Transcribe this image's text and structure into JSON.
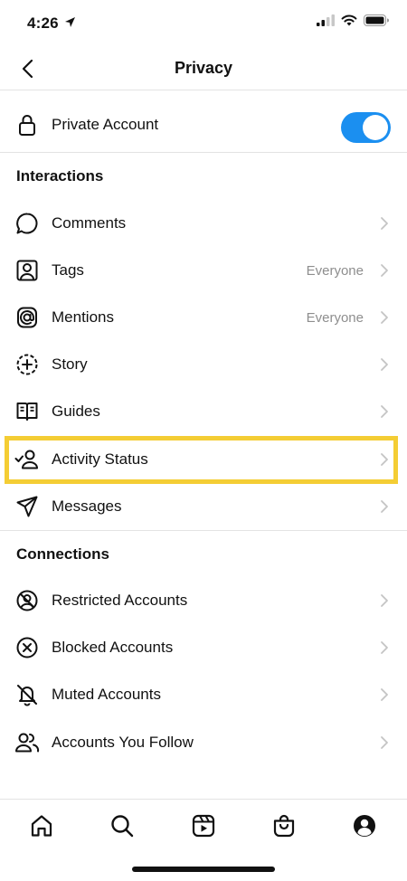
{
  "status_bar": {
    "time": "4:26"
  },
  "nav": {
    "title": "Privacy"
  },
  "private_account": {
    "label": "Private Account",
    "enabled": true
  },
  "interactions": {
    "header": "Interactions",
    "items": [
      {
        "label": "Comments",
        "value": "",
        "icon": "comment-icon"
      },
      {
        "label": "Tags",
        "value": "Everyone",
        "icon": "tag-person-icon"
      },
      {
        "label": "Mentions",
        "value": "Everyone",
        "icon": "at-sign-icon"
      },
      {
        "label": "Story",
        "value": "",
        "icon": "story-add-icon"
      },
      {
        "label": "Guides",
        "value": "",
        "icon": "guide-book-icon"
      },
      {
        "label": "Activity Status",
        "value": "",
        "icon": "activity-status-icon",
        "highlighted": true
      },
      {
        "label": "Messages",
        "value": "",
        "icon": "paper-plane-icon"
      }
    ]
  },
  "connections": {
    "header": "Connections",
    "items": [
      {
        "label": "Restricted Accounts",
        "icon": "restricted-icon"
      },
      {
        "label": "Blocked Accounts",
        "icon": "blocked-icon"
      },
      {
        "label": "Muted Accounts",
        "icon": "muted-bell-icon"
      },
      {
        "label": "Accounts You Follow",
        "icon": "following-users-icon"
      }
    ]
  },
  "tab_bar": [
    "home-icon",
    "search-icon",
    "reels-icon",
    "shop-icon",
    "profile-icon"
  ],
  "colors": {
    "toggle_on": "#1b8ff0",
    "highlight": "#f4cd34",
    "secondary_text": "#8e8e8e"
  }
}
